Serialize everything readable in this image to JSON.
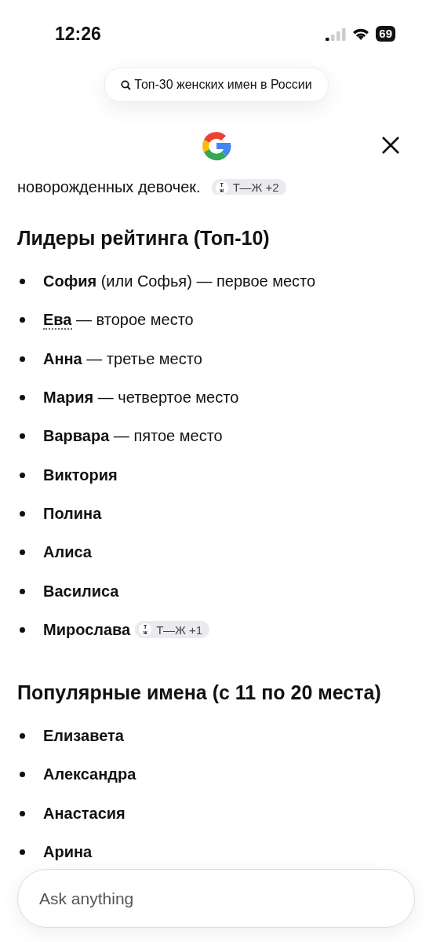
{
  "status_bar": {
    "time": "12:26",
    "battery": "69"
  },
  "query": "Топ-30 женских имен в России",
  "partial_line": {
    "text": "новорожденных девочек.",
    "chip": {
      "icon_top": "Т",
      "icon_bottom": "ж",
      "label": "Т—Ж",
      "count": "+2"
    }
  },
  "sections": [
    {
      "heading": "Лидеры рейтинга (Топ-10)",
      "items": [
        {
          "name": "София",
          "rest": " (или Софья) — первое место",
          "underlined": false
        },
        {
          "name": "Ева",
          "rest": " — второе место",
          "underlined": true
        },
        {
          "name": "Анна",
          "rest": " — третье место",
          "underlined": false
        },
        {
          "name": "Мария",
          "rest": " — четвертое место",
          "underlined": false
        },
        {
          "name": "Варвара",
          "rest": " — пятое место",
          "underlined": false
        },
        {
          "name": "Виктория",
          "underlined": false
        },
        {
          "name": "Полина",
          "underlined": false
        },
        {
          "name": "Алиса",
          "underlined": false
        },
        {
          "name": "Василиса",
          "underlined": false
        },
        {
          "name": "Мирослава",
          "underlined": false,
          "chip": {
            "icon_top": "Т",
            "icon_bottom": "ж",
            "label": "Т—Ж",
            "count": "+1"
          }
        }
      ]
    },
    {
      "heading": "Популярные имена (с 11 по 20 места)",
      "items": [
        {
          "name": "Елизавета",
          "underlined": false
        },
        {
          "name": "Александра",
          "underlined": false
        },
        {
          "name": "Анастасия",
          "underlined": false
        },
        {
          "name": "Арина",
          "underlined": false
        }
      ]
    }
  ],
  "input": {
    "placeholder": "Ask anything"
  }
}
